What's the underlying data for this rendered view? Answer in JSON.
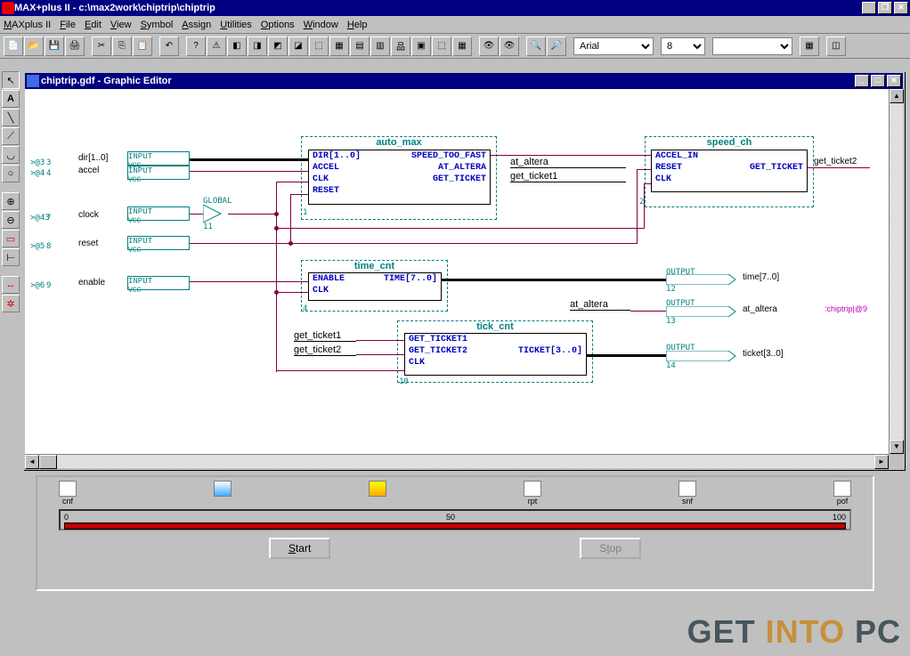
{
  "app": {
    "title": "MAX+plus II - c:\\max2work\\chiptrip\\chiptrip"
  },
  "menu": [
    "MAX+plus II",
    "File",
    "Edit",
    "View",
    "Symbol",
    "Assign",
    "Utilities",
    "Options",
    "Window",
    "Help"
  ],
  "toolbar": {
    "font": "Arial",
    "size": "8"
  },
  "editor": {
    "title": "chiptrip.gdf - Graphic Editor"
  },
  "inputs": {
    "dir": "dir[1..0]",
    "accel": "accel",
    "clock": "clock",
    "reset": "reset",
    "enable": "enable",
    "pin_label": "INPUT",
    "vcc": "VCC",
    "global": "GLOBAL"
  },
  "blocks": {
    "auto_max": {
      "title": "auto_max",
      "rows": [
        {
          "l": "DIR[1..0]",
          "r": "SPEED_TOO_FAST"
        },
        {
          "l": "ACCEL",
          "r": "AT_ALTERA"
        },
        {
          "l": "CLK",
          "r": "GET_TICKET"
        },
        {
          "l": "RESET",
          "r": ""
        }
      ],
      "num": "1"
    },
    "speed_ch": {
      "title": "speed_ch",
      "rows": [
        {
          "l": "ACCEL_IN",
          "r": ""
        },
        {
          "l": "RESET",
          "r": "GET_TICKET"
        },
        {
          "l": "CLK",
          "r": ""
        }
      ],
      "num": "2"
    },
    "time_cnt": {
      "title": "time_cnt",
      "rows": [
        {
          "l": "ENABLE",
          "r": "TIME[7..0]"
        },
        {
          "l": "CLK",
          "r": ""
        }
      ],
      "num": "4"
    },
    "tick_cnt": {
      "title": "tick_cnt",
      "rows": [
        {
          "l": "GET_TICKET1",
          "r": ""
        },
        {
          "l": "GET_TICKET2",
          "r": "TICKET[3..0]"
        },
        {
          "l": "CLK",
          "r": ""
        }
      ],
      "num": "10"
    }
  },
  "nets": {
    "at_altera": "at_altera",
    "get_ticket1": "get_ticket1",
    "get_ticket2": "get_ticket2"
  },
  "outputs": {
    "label": "OUTPUT",
    "get_ticket2": "get_ticket2",
    "time": "time[7..0]",
    "at_altera": "at_altera",
    "ticket": "ticket[3..0]",
    "annotation": ":chiptrip|@9"
  },
  "pin_nums": {
    "p3": ">@3",
    "p4": ">@4",
    "p43": ">@43",
    "p5": ">@5",
    "p6": ">@6",
    "n3": "3",
    "n4": "4",
    "n7": "7",
    "n8": "8",
    "n9": "9",
    "n11": "11",
    "n12": "12",
    "n13": "13",
    "n14": "14"
  },
  "compile": {
    "stages": [
      "cnf",
      "",
      "",
      "rpt",
      "snf",
      "pof"
    ],
    "progress": {
      "min": "0",
      "mid": "50",
      "max": "100"
    },
    "start": "Start",
    "stop": "Stop"
  },
  "watermark": {
    "p1": "GET ",
    "p2": "INTO",
    "p3": " PC"
  }
}
